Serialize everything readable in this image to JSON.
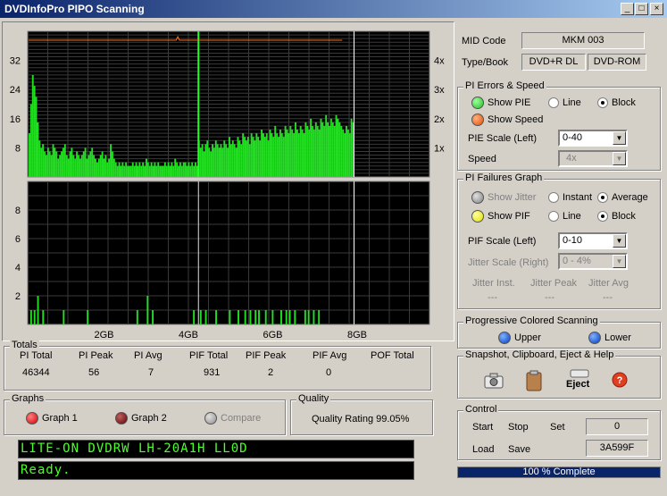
{
  "window": {
    "title": "DVDInfoPro PIPO Scanning",
    "minimize": "_",
    "maximize": "□",
    "close": "×"
  },
  "chart_data": [
    {
      "type": "bar",
      "title": "",
      "xlabel": "",
      "ylabel": "",
      "x_ticks": [
        "2GB",
        "4GB",
        "6GB",
        "8GB"
      ],
      "y_ticks_left": [
        "32",
        "24",
        "16",
        "8"
      ],
      "y_ticks_right": [
        "4x",
        "3x",
        "2x",
        "1x"
      ],
      "ylim": [
        0,
        40
      ],
      "series": [
        {
          "values": [
            12,
            20,
            28,
            25,
            22,
            15,
            10,
            8,
            9,
            7,
            6,
            8,
            7,
            6,
            9,
            8,
            7,
            5,
            6,
            7,
            8,
            9,
            6,
            5,
            7,
            8,
            6,
            5,
            7,
            6,
            5,
            6,
            7,
            8,
            5,
            6,
            7,
            8,
            6,
            5,
            4,
            5,
            6,
            7,
            5,
            6,
            4,
            5,
            9,
            7,
            5,
            4,
            3,
            4,
            3,
            4,
            3,
            4,
            3,
            3,
            3,
            4,
            3,
            4,
            3,
            4,
            3,
            4,
            3,
            5,
            4,
            3,
            4,
            3,
            4,
            3,
            4,
            3,
            3,
            3,
            4,
            3,
            4,
            3,
            4,
            3,
            5,
            4,
            3,
            4,
            3,
            4,
            4,
            3,
            4,
            3,
            4,
            3,
            4,
            3,
            10,
            8,
            9,
            7,
            9,
            10,
            8,
            7,
            9,
            8,
            10,
            9,
            8,
            9,
            8,
            10,
            9,
            8,
            11,
            9,
            10,
            9,
            8,
            11,
            10,
            9,
            12,
            11,
            10,
            11,
            9,
            12,
            11,
            10,
            12,
            11,
            10,
            13,
            12,
            11,
            12,
            10,
            13,
            12,
            11,
            14,
            12,
            11,
            13,
            12,
            11,
            14,
            13,
            12,
            14,
            13,
            12,
            15,
            13,
            12,
            14,
            13,
            12,
            15,
            14,
            13,
            16,
            14,
            13,
            15,
            14,
            13,
            16,
            15,
            14,
            17,
            15,
            14,
            16,
            15,
            14,
            17,
            16,
            15,
            14,
            13,
            12,
            14,
            13,
            12,
            16,
            15
          ]
        },
        {
          "values": [
            3.2,
            3.2,
            3.2,
            3.2,
            3.2,
            3.2,
            3.2,
            3.2,
            3.2,
            3.2,
            3.2,
            3.2,
            3.2,
            3.2,
            3.2,
            3.2,
            3.2,
            3.2,
            3.2,
            3.2,
            3.2,
            3.2,
            3.2,
            3.2,
            3.2,
            3.2,
            3.2,
            3.2,
            3.2,
            3.2,
            3.2,
            3.2,
            3.2,
            3.2,
            3.2,
            3.2,
            3.2,
            3.2,
            3.2,
            3.2,
            3.2,
            3.2,
            3.2,
            3.2,
            3.2,
            3.2,
            3.2,
            3.2,
            3.2,
            3.2,
            3.2,
            3.2,
            3.2,
            3.2,
            3.2,
            3.2,
            3.2,
            3.2,
            3.2,
            3.2,
            3.2,
            3.2,
            3.2,
            3.2,
            3.2,
            3.2,
            3.2,
            3.2,
            3.2,
            3.2,
            3.2,
            3.2,
            3.2,
            3.2,
            3.2,
            3.2,
            3.2,
            3.2,
            3.2,
            3.2,
            3.2,
            3.2,
            3.2,
            3.2,
            3.2,
            3.2,
            3.2,
            3.2,
            3.4,
            3.2,
            3.2,
            3.2,
            3.2,
            3.2,
            3.2,
            3.2,
            3.2,
            3.2,
            3.2,
            3.2,
            3.2,
            3.2,
            3.2,
            3.2,
            3.2,
            3.2,
            3.2,
            3.2,
            3.2,
            3.2,
            3.2,
            3.2,
            3.2,
            3.2,
            3.2,
            3.2,
            3.2,
            3.2,
            3.2,
            3.2,
            3.2,
            3.2,
            3.2,
            3.2,
            3.2,
            3.2,
            3.2,
            3.2,
            3.2,
            3.2,
            3.2,
            3.2,
            3.2,
            3.2,
            3.2,
            3.2,
            3.2,
            3.2,
            3.2,
            3.2,
            3.2,
            3.2,
            3.2,
            3.2,
            3.2,
            3.2,
            3.2,
            3.2,
            3.2,
            3.2,
            3.2,
            3.2,
            3.2,
            3.2,
            3.2,
            3.2,
            3.2,
            3.2,
            3.2,
            3.2,
            3.2,
            3.2,
            3.2,
            3.2,
            3.2,
            3.2,
            3.2,
            3.2,
            3.2,
            3.2,
            3.2,
            3.2,
            3.2,
            3.2,
            3.2,
            3.2,
            3.2,
            3.2,
            3.2,
            3.2,
            3.2,
            3.2,
            3.2,
            3.2,
            3.2,
            3.2
          ]
        }
      ]
    },
    {
      "type": "bar",
      "title": "",
      "xlabel": "",
      "ylabel": "",
      "x_ticks": [
        "2GB",
        "4GB",
        "6GB",
        "8GB"
      ],
      "y_ticks_left": [
        "8",
        "6",
        "4",
        "2"
      ],
      "ylim": [
        0,
        10
      ],
      "series": [
        {
          "values": [
            0,
            1,
            0,
            1,
            0,
            2,
            0,
            0,
            1,
            0,
            0,
            0,
            0,
            0,
            0,
            0,
            0,
            0,
            0,
            0,
            1,
            0,
            0,
            0,
            0,
            0,
            0,
            0,
            0,
            0,
            0,
            0,
            0,
            0,
            1,
            0,
            0,
            0,
            0,
            0,
            0,
            0,
            0,
            0,
            0,
            0,
            0,
            0,
            0,
            0,
            0,
            0,
            0,
            0,
            0,
            0,
            0,
            0,
            0,
            0,
            0,
            0,
            0,
            1,
            0,
            0,
            0,
            0,
            0,
            2,
            0,
            0,
            1,
            0,
            0,
            0,
            0,
            0,
            0,
            0,
            0,
            0,
            0,
            0,
            0,
            0,
            0,
            0,
            0,
            0,
            0,
            0,
            0,
            0,
            0,
            0,
            1,
            0,
            0,
            0,
            1,
            0,
            0,
            1,
            0,
            0,
            0,
            0,
            0,
            1,
            0,
            0,
            0,
            0,
            0,
            0,
            0,
            1,
            0,
            0,
            0,
            0,
            1,
            0,
            0,
            0,
            1,
            0,
            0,
            1,
            0,
            0,
            1,
            0,
            1,
            0,
            0,
            0,
            1,
            0,
            0,
            0,
            1,
            0,
            0,
            0,
            0,
            1,
            0,
            0,
            1,
            0,
            1,
            0,
            0,
            1,
            0,
            0,
            0,
            0,
            0,
            1,
            0,
            1,
            0,
            0,
            1,
            0,
            0,
            1,
            0,
            0,
            0,
            0,
            0,
            0,
            0,
            0,
            0,
            0,
            0,
            0,
            0,
            0,
            0,
            0,
            0,
            0,
            0,
            0
          ]
        }
      ]
    }
  ],
  "media": {
    "mid_label": "MID Code",
    "mid_value": "MKM      003",
    "type_label": "Type/Book",
    "type_value": "DVD+R DL",
    "book_value": "DVD-ROM"
  },
  "pi_errors": {
    "title": "PI Errors & Speed",
    "show_pie": "Show PIE",
    "show_speed": "Show Speed",
    "line": "Line",
    "block": "Block",
    "scale_label": "PIE Scale (Left)",
    "scale_value": "0-40",
    "speed_label": "Speed",
    "speed_value": "4x",
    "colors": {
      "pie": "#22dd22",
      "speed": "#ff7020"
    }
  },
  "pi_failures": {
    "title": "PI Failures Graph",
    "show_jitter": "Show Jitter",
    "instant": "Instant",
    "average": "Average",
    "show_pif": "Show PIF",
    "line": "Line",
    "block": "Block",
    "scale_label": "PIF Scale (Left)",
    "scale_value": "0-10",
    "jitter_label": "Jitter Scale (Right)",
    "jitter_value": "0 - 4%",
    "jitter_inst": "Jitter Inst.",
    "jitter_peak": "Jitter Peak",
    "jitter_avg": "Jitter Avg",
    "dash": "---",
    "colors": {
      "pif": "#ffff00"
    }
  },
  "progressive": {
    "title": "Progressive Colored Scanning",
    "upper": "Upper",
    "lower": "Lower"
  },
  "snapshot": {
    "title": "Snapshot,  Clipboard, Eject & Help",
    "eject": "Eject"
  },
  "control": {
    "title": "Control",
    "start": "Start",
    "stop": "Stop",
    "set": "Set",
    "set_value": "0",
    "load": "Load",
    "save": "Save",
    "save_value": "3A599F"
  },
  "progress": {
    "label": "100 % Complete",
    "fraction": 1.0
  },
  "totals": {
    "title": "Totals",
    "headers": [
      "PI Total",
      "PI Peak",
      "PI Avg",
      "PIF Total",
      "PIF Peak",
      "PIF Avg",
      "POF Total"
    ],
    "values": [
      "46344",
      "56",
      "7",
      "931",
      "2",
      "0",
      ""
    ]
  },
  "graphs": {
    "title": "Graphs",
    "graph1": "Graph 1",
    "graph2": "Graph 2",
    "compare": "Compare"
  },
  "quality": {
    "title": "Quality",
    "rating": "Quality Rating 99.05%"
  },
  "lcd": {
    "drive": "LITE-ON DVDRW LH-20A1H LL0D",
    "status": "Ready."
  }
}
